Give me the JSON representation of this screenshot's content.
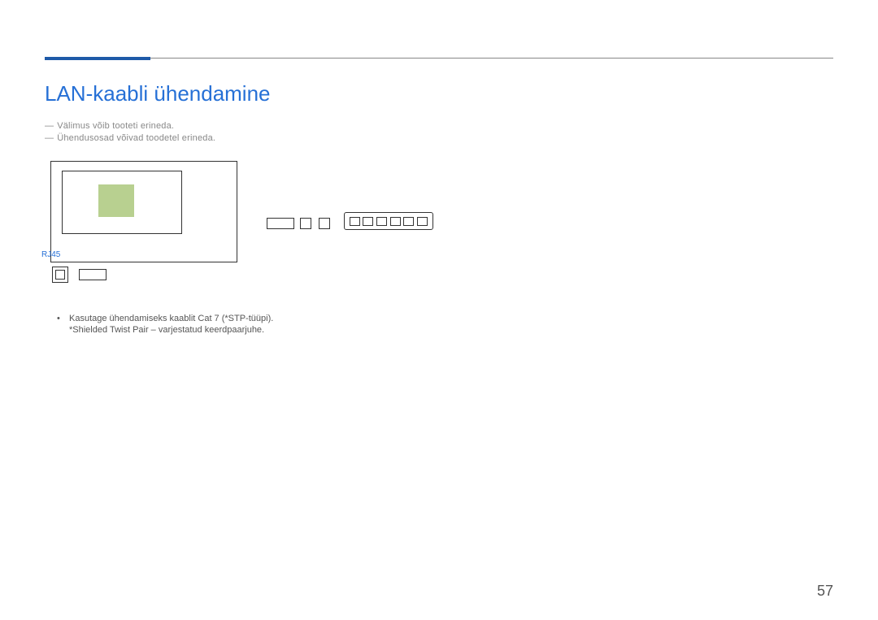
{
  "title": "LAN-kaabli ühendamine",
  "notes": {
    "n1": "Välimus võib tooteti erineda.",
    "n2": "Ühendusosad võivad toodetel erineda."
  },
  "labels": {
    "rj45": "RJ45"
  },
  "bullet": {
    "main": "Kasutage ühendamiseks kaablit Cat 7 (*STP-tüüpi).",
    "sub": "*Shielded Twist Pair – varjestatud keerdpaarjuhe."
  },
  "page_number": "57"
}
